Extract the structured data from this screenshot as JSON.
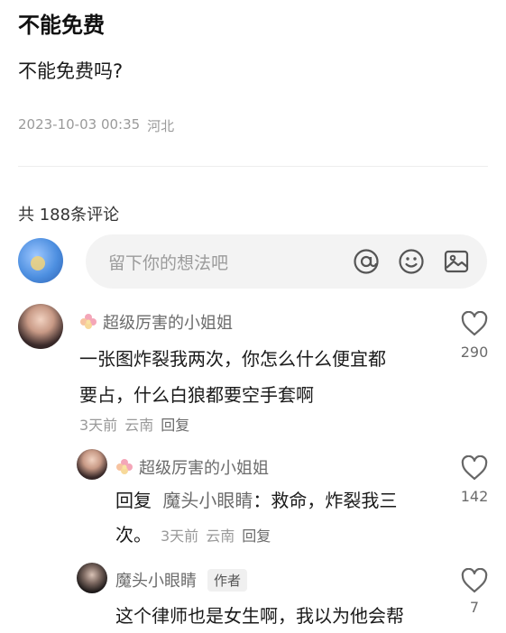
{
  "post": {
    "title": "不能免费",
    "body": "不能免费吗?",
    "date": "2023-10-03 00:35",
    "location": "河北"
  },
  "comments_header": {
    "count_text": "共 188条评论"
  },
  "compose": {
    "placeholder": "留下你的想法吧",
    "icons": [
      "at-icon",
      "emoji-icon",
      "image-icon"
    ]
  },
  "comments": [
    {
      "user": "超级厉害的小姐姐",
      "lines": [
        "一张图炸裂我两次，你怎么什么便宜都",
        "要占，什么白狼都要空手套啊"
      ],
      "time": "3天前",
      "location": "云南",
      "reply_label": "回复",
      "likes": "290"
    },
    {
      "user": "超级厉害的小姐姐",
      "reply_prefix": "回复",
      "reply_target": "魔头小眼睛",
      "line1_rest": "：救命，炸裂我三",
      "line2": "次。",
      "time": "3天前",
      "location": "云南",
      "reply_label": "回复",
      "likes": "142"
    },
    {
      "user": "魔头小眼睛",
      "badge": "作者",
      "line1": "这个律师也是女生啊，我以为他会帮",
      "likes": "7"
    }
  ]
}
